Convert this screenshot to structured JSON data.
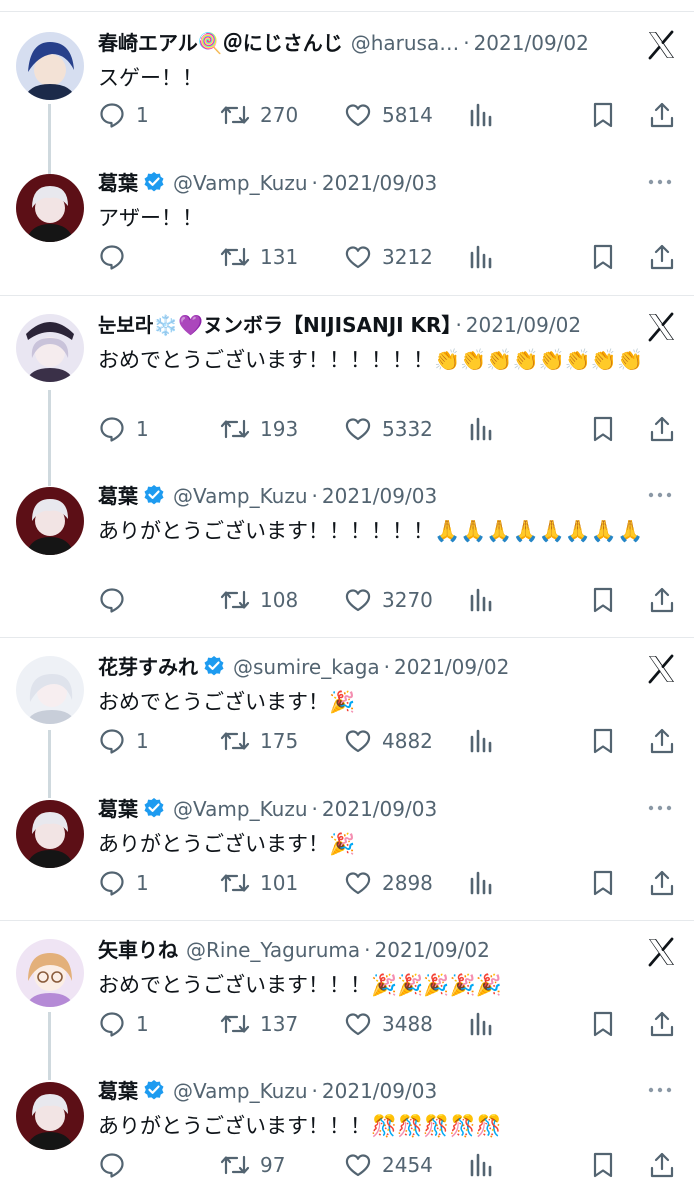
{
  "colors": {
    "text_primary": "#0f1419",
    "text_secondary": "#536471",
    "verified_blue": "#1d9bf0",
    "thread_line": "#cfd9de",
    "divider": "#e6e9ec"
  },
  "icons": {
    "brand": "x-logo-icon",
    "reply": "speech-bubble-icon",
    "retweet": "retweet-arrows-icon",
    "like": "heart-icon",
    "views": "bar-chart-icon",
    "bookmark": "bookmark-icon",
    "share": "share-arrow-icon",
    "more": "three-dots-icon",
    "verified": "verified-badge-icon"
  },
  "threads": [
    {
      "original": {
        "name": "春崎エアル🍭＠にじさんじ",
        "handle": "@harusa…",
        "date": "2021/09/02",
        "text": "スゲー！！",
        "replies": "1",
        "retweets": "270",
        "likes": "5814"
      },
      "reply": {
        "name": "葛葉",
        "handle": "@Vamp_Kuzu",
        "date": "2021/09/03",
        "text": "アザー！！",
        "replies": "",
        "retweets": "131",
        "likes": "3212"
      }
    },
    {
      "original": {
        "name": "눈보라❄️💜ヌンボラ【NIJISANJI KR】",
        "handle": "",
        "date": "2021/09/02",
        "text": "おめでとうございます！！！！！！👏👏👏👏👏👏👏👏",
        "replies": "1",
        "retweets": "193",
        "likes": "5332"
      },
      "reply": {
        "name": "葛葉",
        "handle": "@Vamp_Kuzu",
        "date": "2021/09/03",
        "text": "ありがとうございます！！！！！！🙏🙏🙏🙏🙏🙏🙏🙏",
        "replies": "",
        "retweets": "108",
        "likes": "3270"
      }
    },
    {
      "original": {
        "name": "花芽すみれ",
        "handle": "@sumire_kaga",
        "date": "2021/09/02",
        "text": "おめでとうございます！🎉",
        "replies": "1",
        "retweets": "175",
        "likes": "4882"
      },
      "reply": {
        "name": "葛葉",
        "handle": "@Vamp_Kuzu",
        "date": "2021/09/03",
        "text": "ありがとうございます！🎉",
        "replies": "1",
        "retweets": "101",
        "likes": "2898"
      }
    },
    {
      "original": {
        "name": "矢車りね",
        "handle": "@Rine_Yaguruma",
        "date": "2021/09/02",
        "text": "おめでとうございます！！！🎉🎉🎉🎉🎉",
        "replies": "1",
        "retweets": "137",
        "likes": "3488"
      },
      "reply": {
        "name": "葛葉",
        "handle": "@Vamp_Kuzu",
        "date": "2021/09/03",
        "text": "ありがとうございます！！！🎊🎊🎊🎊🎊",
        "replies": "",
        "retweets": "97",
        "likes": "2454"
      }
    }
  ]
}
